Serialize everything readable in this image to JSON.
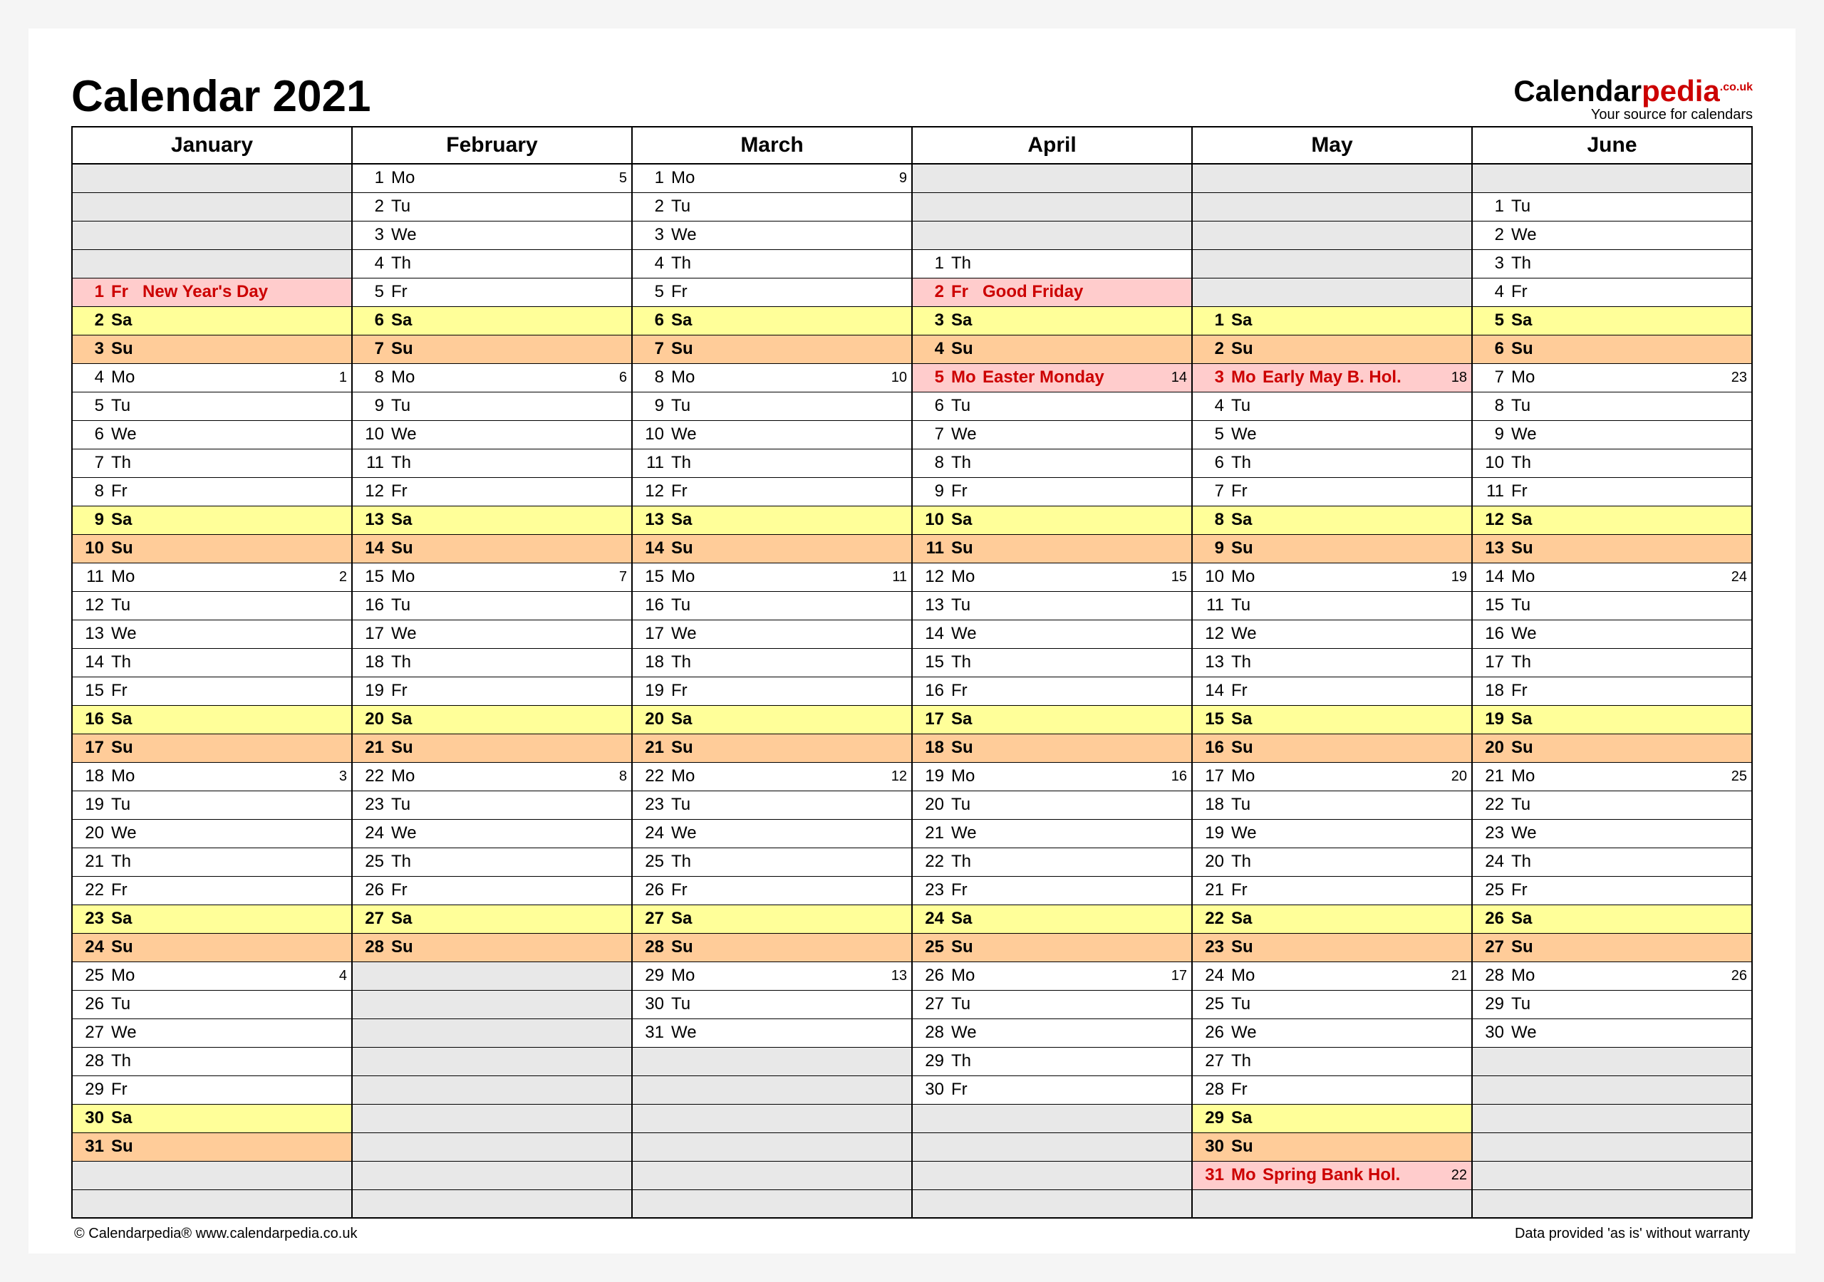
{
  "title": "Calendar 2021",
  "brand": {
    "part1": "Calendar",
    "part2": "pedia",
    "sup": ".co.uk",
    "tagline": "Your source for calendars"
  },
  "footer_left": "© Calendarpedia®    www.calendarpedia.co.uk",
  "footer_right": "Data provided 'as is' without warranty",
  "months": [
    "January",
    "February",
    "March",
    "April",
    "May",
    "June"
  ],
  "rows": 37,
  "columns": [
    {
      "name": "January",
      "offset": 4,
      "days": [
        {
          "n": 1,
          "d": "Fr",
          "note": "New Year's Day",
          "hol": true
        },
        {
          "n": 2,
          "d": "Sa",
          "sat": true,
          "bold": true
        },
        {
          "n": 3,
          "d": "Su",
          "sun": true,
          "bold": true
        },
        {
          "n": 4,
          "d": "Mo",
          "wk": 1
        },
        {
          "n": 5,
          "d": "Tu"
        },
        {
          "n": 6,
          "d": "We"
        },
        {
          "n": 7,
          "d": "Th"
        },
        {
          "n": 8,
          "d": "Fr"
        },
        {
          "n": 9,
          "d": "Sa",
          "sat": true,
          "bold": true
        },
        {
          "n": 10,
          "d": "Su",
          "sun": true,
          "bold": true
        },
        {
          "n": 11,
          "d": "Mo",
          "wk": 2
        },
        {
          "n": 12,
          "d": "Tu"
        },
        {
          "n": 13,
          "d": "We"
        },
        {
          "n": 14,
          "d": "Th"
        },
        {
          "n": 15,
          "d": "Fr"
        },
        {
          "n": 16,
          "d": "Sa",
          "sat": true,
          "bold": true
        },
        {
          "n": 17,
          "d": "Su",
          "sun": true,
          "bold": true
        },
        {
          "n": 18,
          "d": "Mo",
          "wk": 3
        },
        {
          "n": 19,
          "d": "Tu"
        },
        {
          "n": 20,
          "d": "We"
        },
        {
          "n": 21,
          "d": "Th"
        },
        {
          "n": 22,
          "d": "Fr"
        },
        {
          "n": 23,
          "d": "Sa",
          "sat": true,
          "bold": true
        },
        {
          "n": 24,
          "d": "Su",
          "sun": true,
          "bold": true
        },
        {
          "n": 25,
          "d": "Mo",
          "wk": 4
        },
        {
          "n": 26,
          "d": "Tu"
        },
        {
          "n": 27,
          "d": "We"
        },
        {
          "n": 28,
          "d": "Th"
        },
        {
          "n": 29,
          "d": "Fr"
        },
        {
          "n": 30,
          "d": "Sa",
          "sat": true,
          "bold": true
        },
        {
          "n": 31,
          "d": "Su",
          "sun": true,
          "bold": true
        }
      ]
    },
    {
      "name": "February",
      "offset": 0,
      "days": [
        {
          "n": 1,
          "d": "Mo",
          "wk": 5
        },
        {
          "n": 2,
          "d": "Tu"
        },
        {
          "n": 3,
          "d": "We"
        },
        {
          "n": 4,
          "d": "Th"
        },
        {
          "n": 5,
          "d": "Fr"
        },
        {
          "n": 6,
          "d": "Sa",
          "sat": true,
          "bold": true
        },
        {
          "n": 7,
          "d": "Su",
          "sun": true,
          "bold": true
        },
        {
          "n": 8,
          "d": "Mo",
          "wk": 6
        },
        {
          "n": 9,
          "d": "Tu"
        },
        {
          "n": 10,
          "d": "We"
        },
        {
          "n": 11,
          "d": "Th"
        },
        {
          "n": 12,
          "d": "Fr"
        },
        {
          "n": 13,
          "d": "Sa",
          "sat": true,
          "bold": true
        },
        {
          "n": 14,
          "d": "Su",
          "sun": true,
          "bold": true
        },
        {
          "n": 15,
          "d": "Mo",
          "wk": 7
        },
        {
          "n": 16,
          "d": "Tu"
        },
        {
          "n": 17,
          "d": "We"
        },
        {
          "n": 18,
          "d": "Th"
        },
        {
          "n": 19,
          "d": "Fr"
        },
        {
          "n": 20,
          "d": "Sa",
          "sat": true,
          "bold": true
        },
        {
          "n": 21,
          "d": "Su",
          "sun": true,
          "bold": true
        },
        {
          "n": 22,
          "d": "Mo",
          "wk": 8
        },
        {
          "n": 23,
          "d": "Tu"
        },
        {
          "n": 24,
          "d": "We"
        },
        {
          "n": 25,
          "d": "Th"
        },
        {
          "n": 26,
          "d": "Fr"
        },
        {
          "n": 27,
          "d": "Sa",
          "sat": true,
          "bold": true
        },
        {
          "n": 28,
          "d": "Su",
          "sun": true,
          "bold": true
        }
      ]
    },
    {
      "name": "March",
      "offset": 0,
      "days": [
        {
          "n": 1,
          "d": "Mo",
          "wk": 9
        },
        {
          "n": 2,
          "d": "Tu"
        },
        {
          "n": 3,
          "d": "We"
        },
        {
          "n": 4,
          "d": "Th"
        },
        {
          "n": 5,
          "d": "Fr"
        },
        {
          "n": 6,
          "d": "Sa",
          "sat": true,
          "bold": true
        },
        {
          "n": 7,
          "d": "Su",
          "sun": true,
          "bold": true
        },
        {
          "n": 8,
          "d": "Mo",
          "wk": 10
        },
        {
          "n": 9,
          "d": "Tu"
        },
        {
          "n": 10,
          "d": "We"
        },
        {
          "n": 11,
          "d": "Th"
        },
        {
          "n": 12,
          "d": "Fr"
        },
        {
          "n": 13,
          "d": "Sa",
          "sat": true,
          "bold": true
        },
        {
          "n": 14,
          "d": "Su",
          "sun": true,
          "bold": true
        },
        {
          "n": 15,
          "d": "Mo",
          "wk": 11
        },
        {
          "n": 16,
          "d": "Tu"
        },
        {
          "n": 17,
          "d": "We"
        },
        {
          "n": 18,
          "d": "Th"
        },
        {
          "n": 19,
          "d": "Fr"
        },
        {
          "n": 20,
          "d": "Sa",
          "sat": true,
          "bold": true
        },
        {
          "n": 21,
          "d": "Su",
          "sun": true,
          "bold": true
        },
        {
          "n": 22,
          "d": "Mo",
          "wk": 12
        },
        {
          "n": 23,
          "d": "Tu"
        },
        {
          "n": 24,
          "d": "We"
        },
        {
          "n": 25,
          "d": "Th"
        },
        {
          "n": 26,
          "d": "Fr"
        },
        {
          "n": 27,
          "d": "Sa",
          "sat": true,
          "bold": true
        },
        {
          "n": 28,
          "d": "Su",
          "sun": true,
          "bold": true
        },
        {
          "n": 29,
          "d": "Mo",
          "wk": 13
        },
        {
          "n": 30,
          "d": "Tu"
        },
        {
          "n": 31,
          "d": "We"
        }
      ]
    },
    {
      "name": "April",
      "offset": 3,
      "days": [
        {
          "n": 1,
          "d": "Th"
        },
        {
          "n": 2,
          "d": "Fr",
          "note": "Good Friday",
          "hol": true
        },
        {
          "n": 3,
          "d": "Sa",
          "sat": true,
          "bold": true
        },
        {
          "n": 4,
          "d": "Su",
          "sun": true,
          "bold": true
        },
        {
          "n": 5,
          "d": "Mo",
          "note": "Easter Monday",
          "hol": true,
          "wk": 14
        },
        {
          "n": 6,
          "d": "Tu"
        },
        {
          "n": 7,
          "d": "We"
        },
        {
          "n": 8,
          "d": "Th"
        },
        {
          "n": 9,
          "d": "Fr"
        },
        {
          "n": 10,
          "d": "Sa",
          "sat": true,
          "bold": true
        },
        {
          "n": 11,
          "d": "Su",
          "sun": true,
          "bold": true
        },
        {
          "n": 12,
          "d": "Mo",
          "wk": 15
        },
        {
          "n": 13,
          "d": "Tu"
        },
        {
          "n": 14,
          "d": "We"
        },
        {
          "n": 15,
          "d": "Th"
        },
        {
          "n": 16,
          "d": "Fr"
        },
        {
          "n": 17,
          "d": "Sa",
          "sat": true,
          "bold": true
        },
        {
          "n": 18,
          "d": "Su",
          "sun": true,
          "bold": true
        },
        {
          "n": 19,
          "d": "Mo",
          "wk": 16
        },
        {
          "n": 20,
          "d": "Tu"
        },
        {
          "n": 21,
          "d": "We"
        },
        {
          "n": 22,
          "d": "Th"
        },
        {
          "n": 23,
          "d": "Fr"
        },
        {
          "n": 24,
          "d": "Sa",
          "sat": true,
          "bold": true
        },
        {
          "n": 25,
          "d": "Su",
          "sun": true,
          "bold": true
        },
        {
          "n": 26,
          "d": "Mo",
          "wk": 17
        },
        {
          "n": 27,
          "d": "Tu"
        },
        {
          "n": 28,
          "d": "We"
        },
        {
          "n": 29,
          "d": "Th"
        },
        {
          "n": 30,
          "d": "Fr"
        }
      ]
    },
    {
      "name": "May",
      "offset": 5,
      "days": [
        {
          "n": 1,
          "d": "Sa",
          "sat": true,
          "bold": true
        },
        {
          "n": 2,
          "d": "Su",
          "sun": true,
          "bold": true
        },
        {
          "n": 3,
          "d": "Mo",
          "note": "Early May B. Hol.",
          "hol": true,
          "wk": 18
        },
        {
          "n": 4,
          "d": "Tu"
        },
        {
          "n": 5,
          "d": "We"
        },
        {
          "n": 6,
          "d": "Th"
        },
        {
          "n": 7,
          "d": "Fr"
        },
        {
          "n": 8,
          "d": "Sa",
          "sat": true,
          "bold": true
        },
        {
          "n": 9,
          "d": "Su",
          "sun": true,
          "bold": true
        },
        {
          "n": 10,
          "d": "Mo",
          "wk": 19
        },
        {
          "n": 11,
          "d": "Tu"
        },
        {
          "n": 12,
          "d": "We"
        },
        {
          "n": 13,
          "d": "Th"
        },
        {
          "n": 14,
          "d": "Fr"
        },
        {
          "n": 15,
          "d": "Sa",
          "sat": true,
          "bold": true
        },
        {
          "n": 16,
          "d": "Su",
          "sun": true,
          "bold": true
        },
        {
          "n": 17,
          "d": "Mo",
          "wk": 20
        },
        {
          "n": 18,
          "d": "Tu"
        },
        {
          "n": 19,
          "d": "We"
        },
        {
          "n": 20,
          "d": "Th"
        },
        {
          "n": 21,
          "d": "Fr"
        },
        {
          "n": 22,
          "d": "Sa",
          "sat": true,
          "bold": true
        },
        {
          "n": 23,
          "d": "Su",
          "sun": true,
          "bold": true
        },
        {
          "n": 24,
          "d": "Mo",
          "wk": 21
        },
        {
          "n": 25,
          "d": "Tu"
        },
        {
          "n": 26,
          "d": "We"
        },
        {
          "n": 27,
          "d": "Th"
        },
        {
          "n": 28,
          "d": "Fr"
        },
        {
          "n": 29,
          "d": "Sa",
          "sat": true,
          "bold": true
        },
        {
          "n": 30,
          "d": "Su",
          "sun": true,
          "bold": true
        },
        {
          "n": 31,
          "d": "Mo",
          "note": "Spring Bank Hol.",
          "hol": true,
          "wk": 22
        }
      ]
    },
    {
      "name": "June",
      "offset": 1,
      "days": [
        {
          "n": 1,
          "d": "Tu"
        },
        {
          "n": 2,
          "d": "We"
        },
        {
          "n": 3,
          "d": "Th"
        },
        {
          "n": 4,
          "d": "Fr"
        },
        {
          "n": 5,
          "d": "Sa",
          "sat": true,
          "bold": true
        },
        {
          "n": 6,
          "d": "Su",
          "sun": true,
          "bold": true
        },
        {
          "n": 7,
          "d": "Mo",
          "wk": 23
        },
        {
          "n": 8,
          "d": "Tu"
        },
        {
          "n": 9,
          "d": "We"
        },
        {
          "n": 10,
          "d": "Th"
        },
        {
          "n": 11,
          "d": "Fr"
        },
        {
          "n": 12,
          "d": "Sa",
          "sat": true,
          "bold": true
        },
        {
          "n": 13,
          "d": "Su",
          "sun": true,
          "bold": true
        },
        {
          "n": 14,
          "d": "Mo",
          "wk": 24
        },
        {
          "n": 15,
          "d": "Tu"
        },
        {
          "n": 16,
          "d": "We"
        },
        {
          "n": 17,
          "d": "Th"
        },
        {
          "n": 18,
          "d": "Fr"
        },
        {
          "n": 19,
          "d": "Sa",
          "sat": true,
          "bold": true
        },
        {
          "n": 20,
          "d": "Su",
          "sun": true,
          "bold": true
        },
        {
          "n": 21,
          "d": "Mo",
          "wk": 25
        },
        {
          "n": 22,
          "d": "Tu"
        },
        {
          "n": 23,
          "d": "We"
        },
        {
          "n": 24,
          "d": "Th"
        },
        {
          "n": 25,
          "d": "Fr"
        },
        {
          "n": 26,
          "d": "Sa",
          "sat": true,
          "bold": true
        },
        {
          "n": 27,
          "d": "Su",
          "sun": true,
          "bold": true
        },
        {
          "n": 28,
          "d": "Mo",
          "wk": 26
        },
        {
          "n": 29,
          "d": "Tu"
        },
        {
          "n": 30,
          "d": "We"
        }
      ]
    }
  ]
}
